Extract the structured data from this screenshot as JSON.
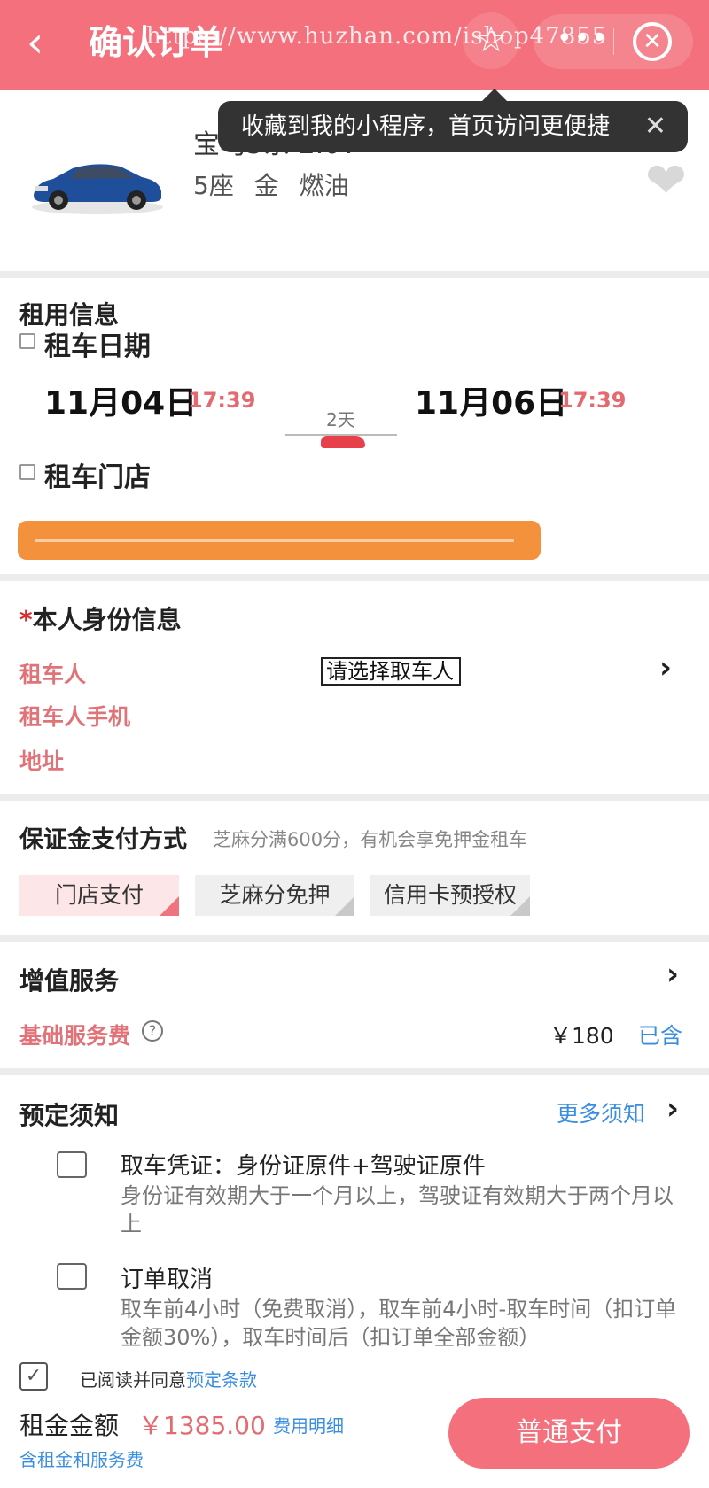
{
  "nav": {
    "back": "‹",
    "title": "确认订单",
    "watermark": "https://www.huzhan.com/ishop47855",
    "star_icon": "☆",
    "more_icon": "•••",
    "close_icon": "✕"
  },
  "car": {
    "name": "宝马5系 2.0T",
    "specs": "5座 金 燃油",
    "heart_icon": "❤"
  },
  "tooltip": {
    "text": "收藏到我的小程序，首页访问更便捷",
    "close": "✕"
  },
  "rent": {
    "title": "租用信息",
    "date_label": "租车日期",
    "start_date": "11月04日",
    "start_time": "17:39",
    "duration": "2天",
    "end_date": "11月06日",
    "end_time": "17:39",
    "store_label": "租车门店"
  },
  "identity": {
    "required_mark": "*",
    "title": "本人身份信息",
    "renter_label": "租车人",
    "renter_placeholder": "请选择取车人",
    "phone_label": "租车人手机",
    "address_label": "地址",
    "chevron": "›"
  },
  "deposit": {
    "title": "保证金支付方式",
    "hint": "芝麻分满600分，有机会享免押金租车",
    "options": [
      "门店支付",
      "芝麻分免押",
      "信用卡预授权"
    ],
    "selected": "门店支付"
  },
  "service": {
    "title": "增值服务",
    "fee_label": "基础服务费",
    "help_icon": "?",
    "fee_price": "￥180",
    "fee_status": "已含",
    "chevron": "›"
  },
  "notice": {
    "title": "预定须知",
    "more": "更多须知",
    "chevron": "›",
    "items": [
      {
        "icon": "id-card-icon",
        "head": "取车凭证：身份证原件+驾驶证原件",
        "body": "身份证有效期大于一个月以上，驾驶证有效期大于两个月以上"
      },
      {
        "icon": "cancel-doc-icon",
        "head": "订单取消",
        "body": "取车前4小时（免费取消），取车前4小时-取车时间（扣订单金额30%），取车时间后（扣订单全部金额）"
      }
    ]
  },
  "footer": {
    "check_mark": "✓",
    "agree_text": "已阅读并同意",
    "agree_link": "预定条款",
    "total_label": "租金金额",
    "total_amount": "￥1385.00",
    "detail_link": "费用明细",
    "total_sub": "含租金和服务费",
    "pay_button": "普通支付"
  },
  "colors": {
    "brand": "#f3707c",
    "accent_red": "#e46a70",
    "link_blue": "#3a8ee0",
    "store_orange": "#f4913c"
  }
}
